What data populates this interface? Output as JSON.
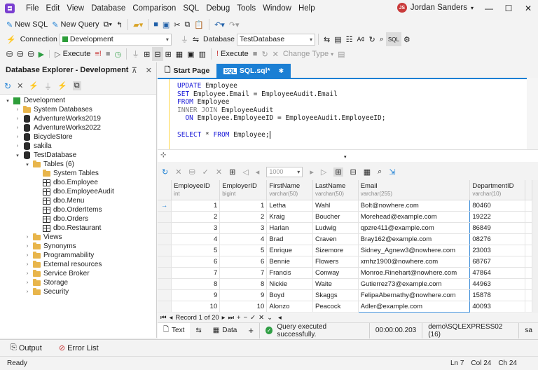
{
  "menu": [
    "File",
    "Edit",
    "View",
    "Database",
    "Comparison",
    "SQL",
    "Debug",
    "Tools",
    "Window",
    "Help"
  ],
  "user": {
    "initials": "JS",
    "name": "Jordan Sanders"
  },
  "toolbar1": {
    "new_sql": "New SQL",
    "new_query": "New Query"
  },
  "toolbar2": {
    "connection_label": "Connection",
    "connection_value": "Development",
    "database_label": "Database",
    "database_value": "TestDatabase"
  },
  "toolbar3": {
    "execute": "Execute",
    "execute2": "Execute",
    "change_type": "Change Type"
  },
  "explorer": {
    "title": "Database Explorer - Development",
    "tree": [
      {
        "label": "Development",
        "icon": "server-icon",
        "level": 0,
        "expanded": true
      },
      {
        "label": "System Databases",
        "icon": "folder-icon",
        "level": 1,
        "expanded": false
      },
      {
        "label": "AdventureWorks2019",
        "icon": "database-icon",
        "level": 1,
        "expanded": false
      },
      {
        "label": "AdventureWorks2022",
        "icon": "database-icon",
        "level": 1,
        "expanded": false
      },
      {
        "label": "BicycleStore",
        "icon": "database-icon",
        "level": 1,
        "expanded": false
      },
      {
        "label": "sakila",
        "icon": "database-icon",
        "level": 1,
        "expanded": false
      },
      {
        "label": "TestDatabase",
        "icon": "database-icon",
        "level": 1,
        "expanded": true
      },
      {
        "label": "Tables (6)",
        "icon": "folder-icon",
        "level": 2,
        "expanded": true
      },
      {
        "label": "System Tables",
        "icon": "folder-icon",
        "level": 3,
        "expanded": false
      },
      {
        "label": "dbo.Employee",
        "icon": "table-icon",
        "level": 3,
        "expanded": false
      },
      {
        "label": "dbo.EmployeeAudit",
        "icon": "table-icon",
        "level": 3,
        "expanded": false
      },
      {
        "label": "dbo.Menu",
        "icon": "table-icon",
        "level": 3,
        "expanded": false
      },
      {
        "label": "dbo.OrderItems",
        "icon": "table-icon",
        "level": 3,
        "expanded": false
      },
      {
        "label": "dbo.Orders",
        "icon": "table-icon",
        "level": 3,
        "expanded": false
      },
      {
        "label": "dbo.Restaurant",
        "icon": "table-icon",
        "level": 3,
        "expanded": false
      },
      {
        "label": "Views",
        "icon": "folder-icon",
        "level": 2,
        "expanded": false
      },
      {
        "label": "Synonyms",
        "icon": "folder-icon",
        "level": 2,
        "expanded": false
      },
      {
        "label": "Programmability",
        "icon": "folder-icon",
        "level": 2,
        "expanded": false
      },
      {
        "label": "External resources",
        "icon": "folder-icon",
        "level": 2,
        "expanded": false
      },
      {
        "label": "Service Broker",
        "icon": "folder-icon",
        "level": 2,
        "expanded": false
      },
      {
        "label": "Storage",
        "icon": "folder-icon",
        "level": 2,
        "expanded": false
      },
      {
        "label": "Security",
        "icon": "folder-icon",
        "level": 2,
        "expanded": false
      }
    ]
  },
  "tabs": {
    "start_page": "Start Page",
    "sql_tab": "SQL.sql*"
  },
  "editor": {
    "lines": [
      [
        [
          "kw",
          "UPDATE"
        ],
        [
          "t",
          " Employee"
        ]
      ],
      [
        [
          "kw",
          "SET"
        ],
        [
          "t",
          " Employee.Email = EmployeeAudit.Email"
        ]
      ],
      [
        [
          "kw",
          "FROM"
        ],
        [
          "t",
          " Employee"
        ]
      ],
      [
        [
          "kw2",
          "INNER JOIN"
        ],
        [
          "t",
          " EmployeeAudit"
        ]
      ],
      [
        [
          "t",
          "  "
        ],
        [
          "kw",
          "ON"
        ],
        [
          "t",
          " Employee.EmployeeID = EmployeeAudit.EmployeeID;"
        ]
      ],
      [
        [
          "t",
          ""
        ]
      ],
      [
        [
          "kw",
          "SELECT"
        ],
        [
          "t",
          " * "
        ],
        [
          "kw",
          "FROM"
        ],
        [
          "t",
          " Employee;"
        ]
      ]
    ]
  },
  "grid": {
    "page_size": "1000",
    "columns": [
      {
        "name": "EmployeeID",
        "type": "int"
      },
      {
        "name": "EmployerID",
        "type": "bigint"
      },
      {
        "name": "FirstName",
        "type": "varchar(50)"
      },
      {
        "name": "LastName",
        "type": "varchar(50)"
      },
      {
        "name": "Email",
        "type": "varchar(255)"
      },
      {
        "name": "DepartmentID",
        "type": "varchar(10)"
      }
    ],
    "rows": [
      [
        "1",
        "1",
        "Letha",
        "Wahl",
        "Bolt@nowhere.com",
        "80460"
      ],
      [
        "2",
        "2",
        "Kraig",
        "Boucher",
        "Morehead@example.com",
        "19222"
      ],
      [
        "3",
        "3",
        "Harlan",
        "Ludwig",
        "qpzre411@example.com",
        "86849"
      ],
      [
        "4",
        "4",
        "Brad",
        "Craven",
        "Bray162@example.com",
        "08276"
      ],
      [
        "5",
        "5",
        "Enrique",
        "Sizemore",
        "Sidney_Agnew3@nowhere.com",
        "23003"
      ],
      [
        "6",
        "6",
        "Bennie",
        "Flowers",
        "xmhz1900@nowhere.com",
        "68767"
      ],
      [
        "7",
        "7",
        "Francis",
        "Conway",
        "Monroe.Rinehart@nowhere.com",
        "47864"
      ],
      [
        "8",
        "8",
        "Nickie",
        "Waite",
        "Gutierrez73@example.com",
        "44963"
      ],
      [
        "9",
        "9",
        "Boyd",
        "Skaggs",
        "FelipaAbernathy@nowhere.com",
        "15878"
      ],
      [
        "10",
        "10",
        "Alonzo",
        "Peacock",
        "Adler@example.com",
        "40093"
      ]
    ],
    "record_label": "Record 1 of 20"
  },
  "status_tabs": {
    "text": "Text",
    "data": "Data"
  },
  "status": {
    "message": "Query executed successfully.",
    "elapsed": "00:00:00.203",
    "server": "demo\\SQLEXPRESS02 (16)",
    "user": "sa"
  },
  "bottom": {
    "output": "Output",
    "error_list": "Error List"
  },
  "statusbar": {
    "state": "Ready",
    "ln": "Ln 7",
    "col": "Col 24",
    "ch": "Ch 24"
  },
  "colors": {
    "accent": "#1b7fd4",
    "keyword": "#1a1ad8",
    "success": "#2f9e44",
    "user_avatar": "#c93a3a"
  }
}
